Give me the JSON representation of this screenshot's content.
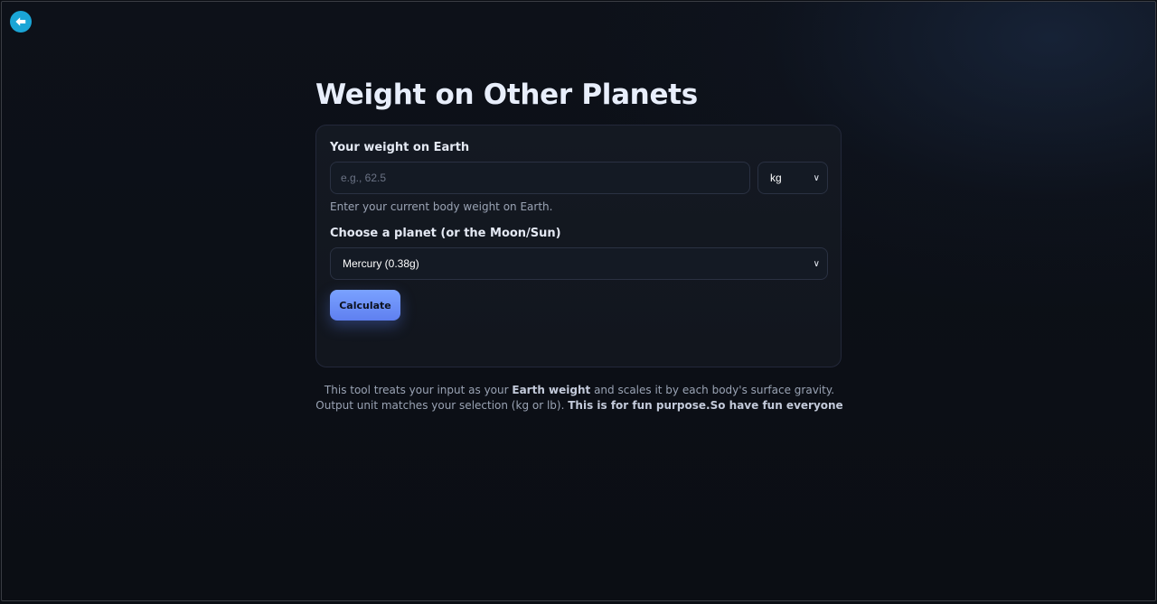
{
  "page": {
    "title": "Weight on Other Planets"
  },
  "back_button": {
    "icon": "arrow-left-icon",
    "color": "#1aa5d6"
  },
  "form": {
    "weight_label": "Your weight on Earth",
    "weight_placeholder": "e.g., 62.5",
    "weight_value": "",
    "unit_selected": "kg",
    "unit_options_visible": [
      "kg"
    ],
    "weight_help": "Enter your current body weight on Earth.",
    "planet_label": "Choose a planet (or the Moon/Sun)",
    "planet_selected": "Mercury (0.38g)",
    "calculate_label": "Calculate"
  },
  "footnote": {
    "part1": "This tool treats your input as your ",
    "bold1": "Earth weight",
    "part2": " and scales it by each body's surface gravity. Output unit matches your selection (kg or lb). ",
    "bold2": "This is for fun purpose.So have fun everyone"
  },
  "colors": {
    "background": "#0b0e14",
    "accent": "#7aa2ff",
    "back_button": "#1aa5d6"
  }
}
